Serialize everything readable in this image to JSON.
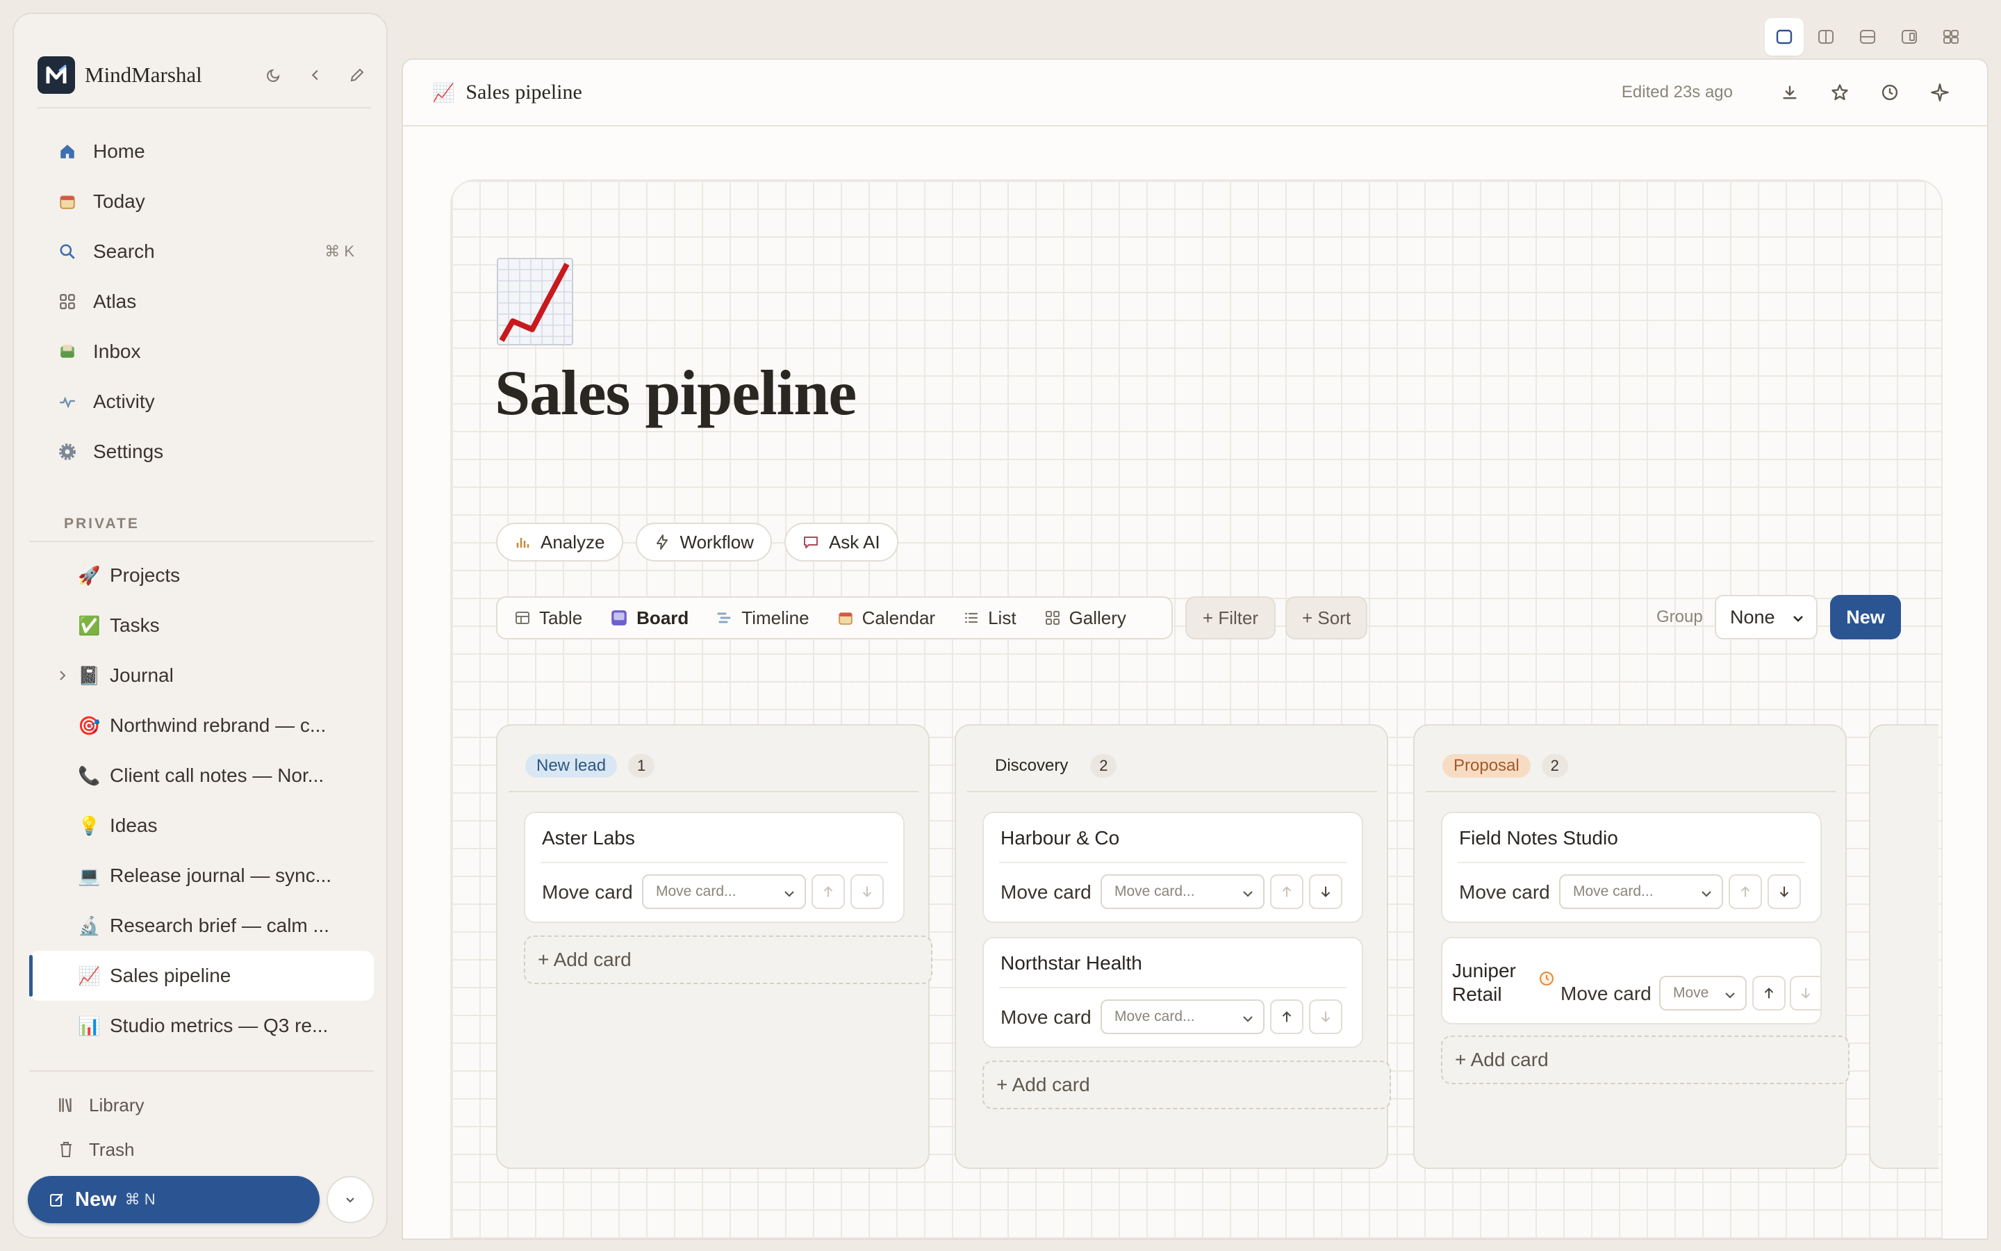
{
  "sidebar": {
    "brand": "MindMarshal",
    "nav": [
      {
        "label": "Home",
        "icon": "home-icon"
      },
      {
        "label": "Today",
        "icon": "calendar-icon"
      },
      {
        "label": "Search",
        "icon": "search-icon",
        "shortcut": "⌘ K"
      },
      {
        "label": "Atlas",
        "icon": "grid-icon"
      },
      {
        "label": "Inbox",
        "icon": "inbox-icon"
      },
      {
        "label": "Activity",
        "icon": "activity-icon"
      },
      {
        "label": "Settings",
        "icon": "gear-icon"
      }
    ],
    "section_label": "PRIVATE",
    "pages": [
      {
        "emoji": "🚀",
        "label": "Projects"
      },
      {
        "emoji": "✅",
        "label": "Tasks"
      },
      {
        "emoji": "📓",
        "label": "Journal"
      },
      {
        "emoji": "🎯",
        "label": "Northwind rebrand — c..."
      },
      {
        "emoji": "📞",
        "label": "Client call notes — Nor..."
      },
      {
        "emoji": "💡",
        "label": "Ideas"
      },
      {
        "emoji": "💻",
        "label": "Release journal — sync..."
      },
      {
        "emoji": "🔬",
        "label": "Research brief — calm ..."
      },
      {
        "emoji": "📈",
        "label": "Sales pipeline"
      },
      {
        "emoji": "📊",
        "label": "Studio metrics — Q3 re..."
      }
    ],
    "library_label": "Library",
    "trash_label": "Trash",
    "new_label": "New",
    "new_shortcut": "⌘ N"
  },
  "topbar": {
    "emoji": "📈",
    "title": "Sales pipeline",
    "edited": "Edited 23s ago"
  },
  "page": {
    "title": "Sales pipeline",
    "actions": [
      "Analyze",
      "Workflow",
      "Ask AI"
    ],
    "views": [
      "Table",
      "Board",
      "Timeline",
      "Calendar",
      "List",
      "Gallery"
    ],
    "selected_view": "Board",
    "filter_label": "+ Filter",
    "sort_label": "+ Sort",
    "group_label": "Group",
    "group_value": "None",
    "new_label": "New"
  },
  "board": {
    "move_label": "Move card",
    "move_placeholder": "Move card...",
    "move_placeholder_short": "Move",
    "add_card_label": "+ Add card",
    "columns": [
      {
        "name": "New lead",
        "count": "1",
        "cards": [
          "Aster Labs"
        ],
        "tag_bg": "#d9e6f3",
        "tag_fg": "#2f5680"
      },
      {
        "name": "Discovery",
        "count": "2",
        "cards": [
          "Harbour & Co",
          "Northstar Health"
        ],
        "tag_bg": "transparent",
        "tag_fg": "#2a2622"
      },
      {
        "name": "Proposal",
        "count": "2",
        "cards": [
          "Field Notes Studio",
          "Juniper Retail"
        ],
        "tag_bg": "#f7dcc4",
        "tag_fg": "#a4582a"
      }
    ]
  },
  "colors": {
    "accent": "#2b5592",
    "active_bar": "#2e5a93"
  }
}
